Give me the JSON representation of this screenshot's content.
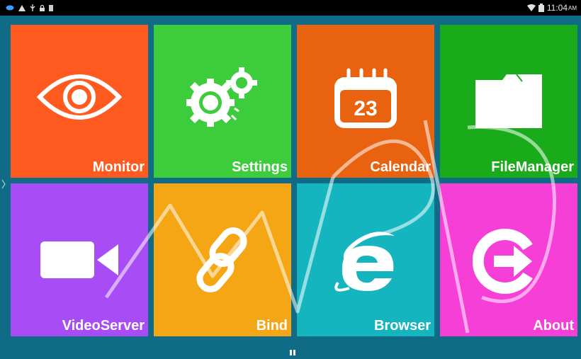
{
  "status_bar": {
    "icons_left": [
      "message-icon",
      "warning-icon",
      "usb-icon",
      "lock-icon",
      "sd-card-icon"
    ],
    "icons_right": [
      "wifi-icon",
      "battery-icon"
    ],
    "time": "11:04",
    "ampm": "AM"
  },
  "tiles": [
    {
      "id": "monitor",
      "label": "Monitor",
      "icon": "eye-icon",
      "color": "#ff5a1f"
    },
    {
      "id": "settings",
      "label": "Settings",
      "icon": "gears-icon",
      "color": "#3ccc3c"
    },
    {
      "id": "calendar",
      "label": "Calendar",
      "icon": "calendar-icon",
      "color": "#e8620f",
      "icon_text": "23"
    },
    {
      "id": "filemanager",
      "label": "FileManager",
      "icon": "folder-icon",
      "color": "#1aab1a"
    },
    {
      "id": "videoserver",
      "label": "VideoServer",
      "icon": "video-camera-icon",
      "color": "#a84df5"
    },
    {
      "id": "bind",
      "label": "Bind",
      "icon": "link-icon",
      "color": "#f5a614"
    },
    {
      "id": "browser",
      "label": "Browser",
      "icon": "browser-e-icon",
      "color": "#14b5bf"
    },
    {
      "id": "about",
      "label": "About",
      "icon": "exit-arrow-icon",
      "color": "#f53fd6"
    }
  ],
  "watermark": {
    "text": "WPD"
  }
}
